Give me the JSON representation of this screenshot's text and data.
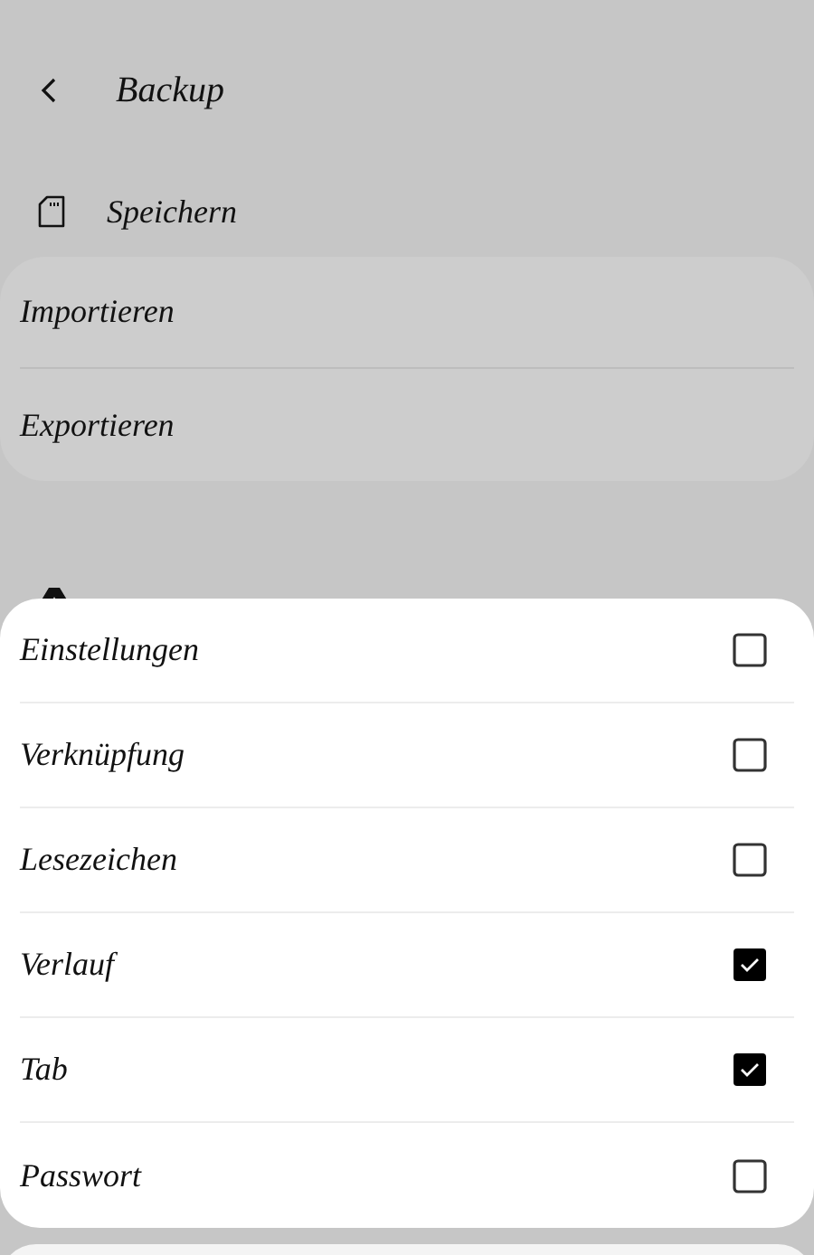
{
  "header": {
    "title": "Backup"
  },
  "storage": {
    "label": "Speichern"
  },
  "actions": [
    {
      "label": "Importieren"
    },
    {
      "label": "Exportieren"
    }
  ],
  "sheet": {
    "options": [
      {
        "label": "Einstellungen",
        "checked": false
      },
      {
        "label": "Verknüpfung",
        "checked": false
      },
      {
        "label": "Lesezeichen",
        "checked": false
      },
      {
        "label": "Verlauf",
        "checked": true
      },
      {
        "label": "Tab",
        "checked": true
      },
      {
        "label": "Passwort",
        "checked": false
      }
    ]
  }
}
